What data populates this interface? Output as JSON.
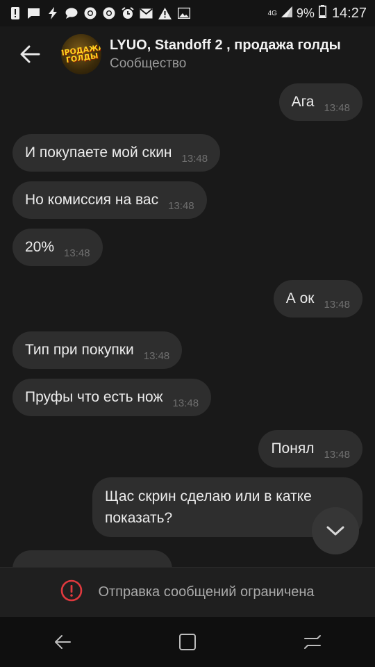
{
  "status_bar": {
    "network": "4G",
    "battery": "9%",
    "time": "14:27",
    "icons": [
      "alert-icon",
      "message-icon",
      "lightning-icon",
      "chat-icon",
      "chrome-icon",
      "chrome-icon",
      "alarm-icon",
      "mail-icon",
      "warning-icon",
      "image-icon"
    ]
  },
  "header": {
    "title": "LYUO, Standoff 2 , продажа голды",
    "subtitle": "Сообщество",
    "avatar_text": "ПРОДАЖА ГОЛДЫ"
  },
  "messages": [
    {
      "side": "out",
      "text": "Ага",
      "time": "13:48"
    },
    {
      "side": "in",
      "text": "И покупаете мой скин",
      "time": "13:48"
    },
    {
      "side": "in",
      "text": "Но комиссия на вас",
      "time": "13:48"
    },
    {
      "side": "in",
      "text": "20%",
      "time": "13:48"
    },
    {
      "side": "out",
      "text": "А ок",
      "time": "13:48"
    },
    {
      "side": "in",
      "text": "Тип при покупки",
      "time": "13:48"
    },
    {
      "side": "in",
      "text": "Пруфы что есть нож",
      "time": "13:48"
    },
    {
      "side": "out",
      "text": "Понял",
      "time": "13:48"
    },
    {
      "side": "out",
      "text": "Щас скрин сделаю или в катке показать?",
      "time": ""
    }
  ],
  "restriction": {
    "text": "Отправка сообщений ограничена"
  },
  "colors": {
    "background": "#191919",
    "bubble": "#2e2e2e",
    "restrict_icon": "#e0393e"
  }
}
